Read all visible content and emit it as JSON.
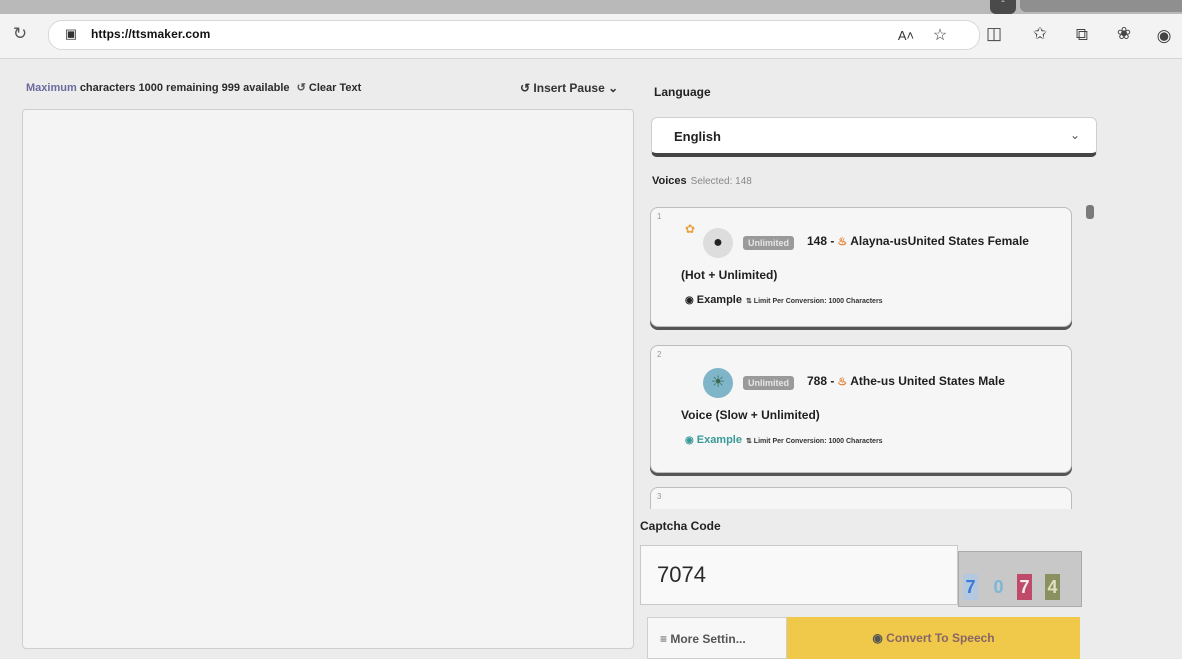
{
  "browser": {
    "url": "https://ttsmaker.com",
    "reader_icon": "A˄",
    "icons": [
      "refresh-icon",
      "lock-icon",
      "read-aloud-icon",
      "favorite-star-icon",
      "split-screen-icon",
      "favorites-icon",
      "collections-icon",
      "extensions-icon",
      "profile-icon"
    ]
  },
  "editor": {
    "prefix": "Maximum",
    "info": "characters 1000 remaining 999 available",
    "clear_label": "Clear Text",
    "insert_pause_label": "Insert Pause",
    "text": ""
  },
  "language": {
    "label": "Language",
    "selected": "English"
  },
  "voices": {
    "label": "Voices",
    "sub_label": "Selected: 148",
    "items": [
      {
        "number": "1",
        "badge": "Unlimited",
        "title": "148 -",
        "name": "Alayna-usUnited States Female",
        "subtitle": "(Hot + Unlimited)",
        "example": "Example",
        "limit": "Limit Per Conversion: 1000 Characters",
        "example_color": "#222222"
      },
      {
        "number": "2",
        "badge": "Unlimited",
        "title": "788 -",
        "name": "Athe-us United States Male",
        "subtitle": "Voice (Slow + Unlimited)",
        "example": "Example",
        "limit": "Limit Per Conversion: 1000 Characters",
        "example_color": "#3a9a9a"
      },
      {
        "number": "3"
      }
    ]
  },
  "captcha": {
    "label": "Captcha Code",
    "value": "7074",
    "image_chars": [
      "7",
      "0",
      "7",
      "4"
    ]
  },
  "actions": {
    "more_settings": "More Settin...",
    "convert": "Convert To Speech"
  },
  "colors": {
    "convert_bg": "#f0c84a",
    "fire": "#e07a2a",
    "badge_bg": "#9a9a9a"
  }
}
